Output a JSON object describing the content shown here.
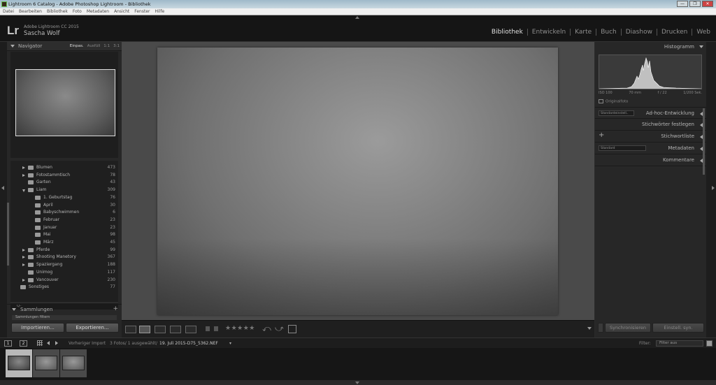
{
  "window": {
    "title": "Lightroom 6 Catalog - Adobe Photoshop Lightroom - Bibliothek",
    "controls": [
      "—",
      "❒",
      "✕"
    ]
  },
  "menu": [
    "Datei",
    "Bearbeiten",
    "Bibliothek",
    "Foto",
    "Metadaten",
    "Ansicht",
    "Fenster",
    "Hilfe"
  ],
  "identity": {
    "logo": "Lr",
    "app_name": "Adobe Lightroom CC 2015",
    "user": "Sascha Wolf"
  },
  "modules": [
    {
      "label": "Bibliothek",
      "active": true
    },
    {
      "label": "Entwickeln",
      "active": false
    },
    {
      "label": "Karte",
      "active": false
    },
    {
      "label": "Buch",
      "active": false
    },
    {
      "label": "Diashow",
      "active": false
    },
    {
      "label": "Drucken",
      "active": false
    },
    {
      "label": "Web",
      "active": false
    }
  ],
  "navigator": {
    "title": "Navigator",
    "zooms": [
      "Einpas.",
      "Ausfüll",
      "1:1",
      "3:1"
    ],
    "selected_zoom": "Einpas."
  },
  "folders": [
    {
      "name": "Blumen",
      "count": "473",
      "level": 1,
      "expanded": false,
      "has_children": true
    },
    {
      "name": "Fotostammtisch",
      "count": "78",
      "level": 1,
      "expanded": false,
      "has_children": true
    },
    {
      "name": "Garten",
      "count": "43",
      "level": 1,
      "expanded": false,
      "has_children": false
    },
    {
      "name": "Liam",
      "count": "309",
      "level": 1,
      "expanded": true,
      "has_children": true
    },
    {
      "name": "1. Geburtstag",
      "count": "76",
      "level": 2,
      "expanded": false,
      "has_children": false
    },
    {
      "name": "April",
      "count": "30",
      "level": 2,
      "expanded": false,
      "has_children": false
    },
    {
      "name": "Babyschwimmen",
      "count": "6",
      "level": 2,
      "expanded": false,
      "has_children": false
    },
    {
      "name": "Februar",
      "count": "23",
      "level": 2,
      "expanded": false,
      "has_children": false
    },
    {
      "name": "Januar",
      "count": "23",
      "level": 2,
      "expanded": false,
      "has_children": false
    },
    {
      "name": "Mai",
      "count": "98",
      "level": 2,
      "expanded": false,
      "has_children": false
    },
    {
      "name": "März",
      "count": "45",
      "level": 2,
      "expanded": false,
      "has_children": false
    },
    {
      "name": "Pferde",
      "count": "99",
      "level": 1,
      "expanded": false,
      "has_children": true
    },
    {
      "name": "Shooting Manetory",
      "count": "367",
      "level": 1,
      "expanded": false,
      "has_children": true
    },
    {
      "name": "Spaziergang",
      "count": "188",
      "level": 1,
      "expanded": false,
      "has_children": true
    },
    {
      "name": "Unimog",
      "count": "117",
      "level": 1,
      "expanded": false,
      "has_children": false
    },
    {
      "name": "Vancouver",
      "count": "230",
      "level": 1,
      "expanded": false,
      "has_children": true
    },
    {
      "name": "Sonstiges",
      "count": "77",
      "level": 0,
      "expanded": false,
      "has_children": false
    }
  ],
  "folder_search_placeholder": "Q-",
  "collections": {
    "title": "Sammlungen",
    "add": "+",
    "first_item": "Sammlungen filtern"
  },
  "left_buttons": {
    "import": "Importieren...",
    "export": "Exportieren..."
  },
  "histogram": {
    "title": "Histogramm",
    "iso": "ISO 100",
    "focal": "70 mm",
    "aperture": "f / 22",
    "shutter": "1/200 Sek.",
    "original": "Originalfoto"
  },
  "right_sections": {
    "quick_develop": {
      "label": "Ad-hoc-Entwicklung",
      "preset": "Standardeinstell.."
    },
    "keywording": {
      "label": "Stichwörter festlegen"
    },
    "keyword_list": {
      "label": "Stichwortliste",
      "add": "+"
    },
    "metadata": {
      "label": "Metadaten",
      "preset": "Standard"
    },
    "comments": {
      "label": "Kommentare"
    }
  },
  "right_buttons": {
    "sync": "Synchronisieren",
    "sync_settings": "Einstell. syn."
  },
  "toolbar": {
    "stars": "★★★★★"
  },
  "filmstrip_bar": {
    "monitor1": "1",
    "monitor2": "2",
    "source": "Vorheriger Import",
    "count": "3 Fotos/ 1 ausgewählt/",
    "file": "19. Juli 2015-D75_5362.NEF",
    "filter_label": "Filter:",
    "filter_value": "Filter aus"
  },
  "filmstrip": {
    "thumbnails": 3,
    "selected_index": 0
  },
  "colors": {
    "panel": "#272727",
    "background": "#151515",
    "active_module": "#e0e0e0"
  }
}
